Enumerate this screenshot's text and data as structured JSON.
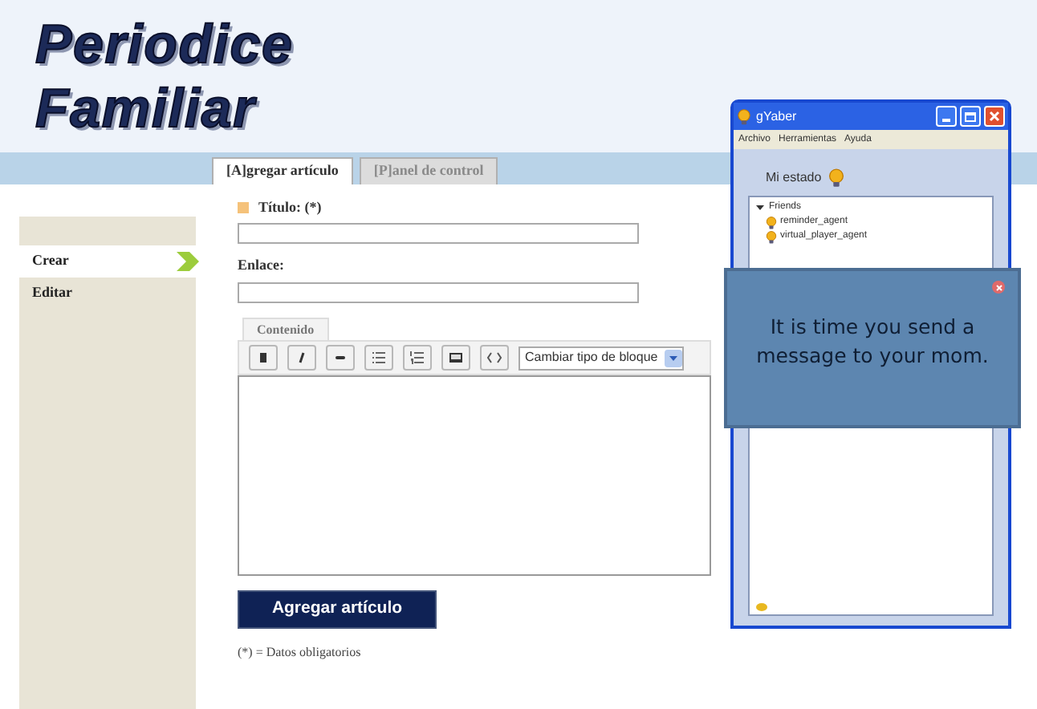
{
  "site_title": [
    "Periodice",
    "Familiar"
  ],
  "tabs": [
    {
      "label": "[A]gregar artículo",
      "selected": true
    },
    {
      "label": "[P]anel de control",
      "selected": false
    }
  ],
  "sidebar": {
    "items": [
      {
        "label": "Crear",
        "selected": true
      },
      {
        "label": "Editar",
        "selected": false
      }
    ]
  },
  "form": {
    "title_label": "Título: (*)",
    "link_label": "Enlace:",
    "content_tab": "Contenido",
    "block_type": "Cambiar tipo de bloque",
    "submit": "Agregar artículo",
    "note": "(*) = Datos obligatorios"
  },
  "chat_window": {
    "title": "gYaber",
    "menu": [
      "Archivo",
      "Herramientas",
      "Ayuda"
    ],
    "status_label": "Mi estado",
    "group": {
      "label": "Friends",
      "expanded": true,
      "children": [
        {
          "label": "reminder_agent"
        },
        {
          "label": "virtual_player_agent"
        }
      ]
    }
  },
  "notification": {
    "message": "It is time you send a message to your mom."
  }
}
